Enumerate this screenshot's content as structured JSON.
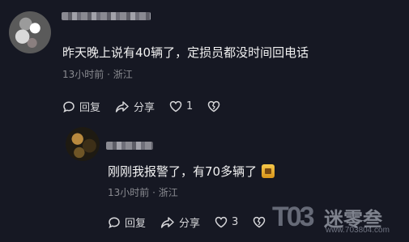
{
  "comments": [
    {
      "text": "昨天晚上说有40辆了，定损员都没时间回电话",
      "meta": "13小时前 · 浙江",
      "reply_label": "回复",
      "share_label": "分享",
      "like_count": "1"
    },
    {
      "text": "刚刚我报警了，有70多辆了",
      "meta": "13小时前 · 浙江",
      "reply_label": "回复",
      "share_label": "分享",
      "like_count": "3"
    }
  ],
  "watermark": {
    "logo": "T03",
    "text": "迷零叁",
    "url": "www.703804.com"
  },
  "colors": {
    "background": "#161823",
    "text": "#f2f2f2",
    "meta": "#8a8b91"
  },
  "icons": [
    "chat-bubble-icon",
    "share-arrow-icon",
    "heart-icon",
    "broken-heart-icon",
    "emoji-icon"
  ]
}
